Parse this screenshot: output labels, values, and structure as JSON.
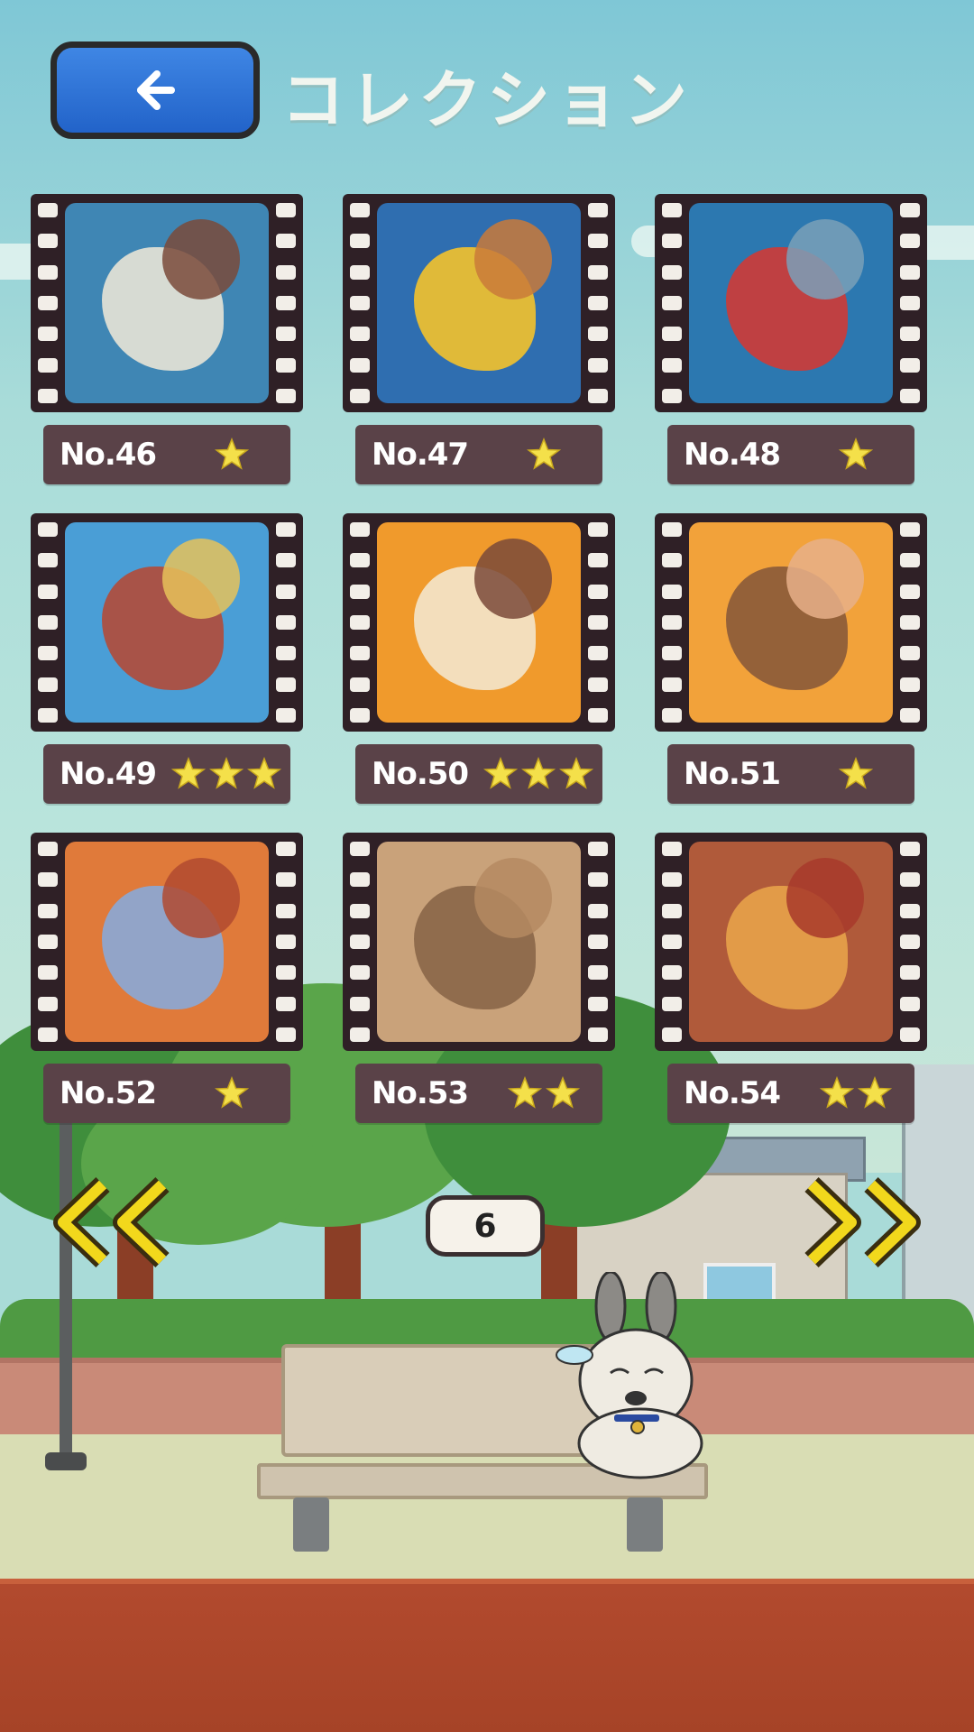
{
  "header": {
    "title": "コレクション",
    "back_icon": "arrow-left-icon"
  },
  "colors": {
    "star": "#f4e04a",
    "label_bg": "#5a4248",
    "film": "#2f2026",
    "back_btn": "#2e74d8",
    "nav_arrow": "#f2d81c"
  },
  "collection": [
    {
      "label": "No.46",
      "stars": 1,
      "palette": [
        "#3f86b4",
        "#e8e4d6",
        "#7a4a3a"
      ]
    },
    {
      "label": "No.47",
      "stars": 1,
      "palette": [
        "#2f6eb0",
        "#f4c22c",
        "#c97a3a"
      ]
    },
    {
      "label": "No.48",
      "stars": 1,
      "palette": [
        "#2c78b0",
        "#cf3a36",
        "#7aa0b8"
      ]
    },
    {
      "label": "No.49",
      "stars": 3,
      "palette": [
        "#4a9ed6",
        "#b24a38",
        "#e6c25a"
      ]
    },
    {
      "label": "No.50",
      "stars": 3,
      "palette": [
        "#f09a2c",
        "#f3e6cc",
        "#7a4a3a"
      ]
    },
    {
      "label": "No.51",
      "stars": 1,
      "palette": [
        "#f2a23a",
        "#8a5a3a",
        "#e8b08a"
      ]
    },
    {
      "label": "No.52",
      "stars": 1,
      "palette": [
        "#e07a3a",
        "#8aa8d8",
        "#b04a30"
      ]
    },
    {
      "label": "No.53",
      "stars": 2,
      "palette": [
        "#c9a27a",
        "#8a6648",
        "#b58a62"
      ]
    },
    {
      "label": "No.54",
      "stars": 2,
      "palette": [
        "#b05a3a",
        "#e8a24a",
        "#a83a2c"
      ]
    }
  ],
  "pagination": {
    "page": "6",
    "prev_icon": "double-chevron-left-icon",
    "next_icon": "double-chevron-right-icon"
  }
}
